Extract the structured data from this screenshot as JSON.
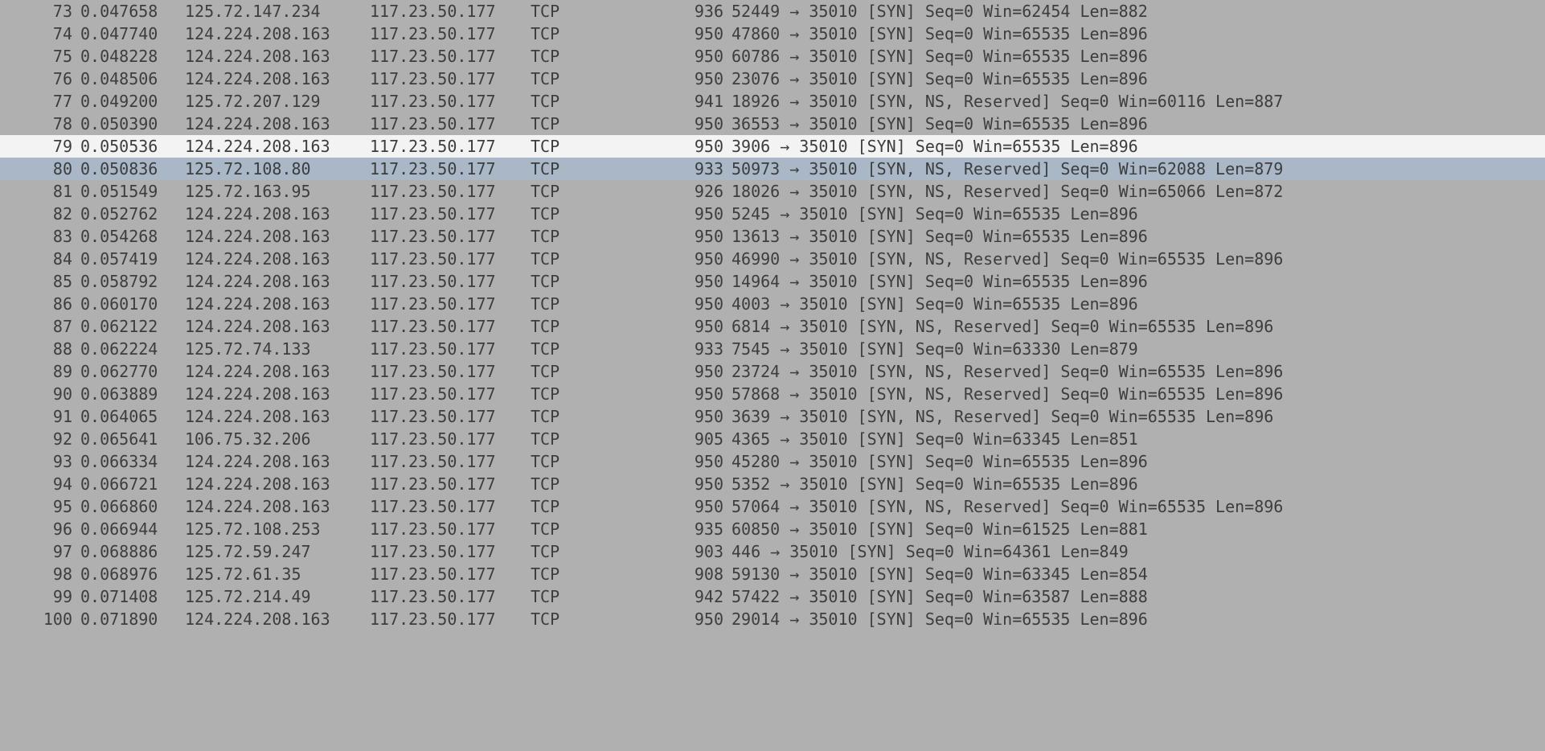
{
  "packets": [
    {
      "no": "73",
      "time": "0.047658",
      "src": "125.72.147.234",
      "dst": "117.23.50.177",
      "proto": "TCP",
      "len": "936",
      "info": "52449 → 35010 [SYN] Seq=0 Win=62454 Len=882",
      "state": "normal"
    },
    {
      "no": "74",
      "time": "0.047740",
      "src": "124.224.208.163",
      "dst": "117.23.50.177",
      "proto": "TCP",
      "len": "950",
      "info": "47860 → 35010 [SYN] Seq=0 Win=65535 Len=896",
      "state": "normal"
    },
    {
      "no": "75",
      "time": "0.048228",
      "src": "124.224.208.163",
      "dst": "117.23.50.177",
      "proto": "TCP",
      "len": "950",
      "info": "60786 → 35010 [SYN] Seq=0 Win=65535 Len=896",
      "state": "normal"
    },
    {
      "no": "76",
      "time": "0.048506",
      "src": "124.224.208.163",
      "dst": "117.23.50.177",
      "proto": "TCP",
      "len": "950",
      "info": "23076 → 35010 [SYN] Seq=0 Win=65535 Len=896",
      "state": "normal"
    },
    {
      "no": "77",
      "time": "0.049200",
      "src": "125.72.207.129",
      "dst": "117.23.50.177",
      "proto": "TCP",
      "len": "941",
      "info": "18926 → 35010 [SYN, NS, Reserved] Seq=0 Win=60116 Len=887",
      "state": "normal"
    },
    {
      "no": "78",
      "time": "0.050390",
      "src": "124.224.208.163",
      "dst": "117.23.50.177",
      "proto": "TCP",
      "len": "950",
      "info": "36553 → 35010 [SYN] Seq=0 Win=65535 Len=896",
      "state": "normal"
    },
    {
      "no": "79",
      "time": "0.050536",
      "src": "124.224.208.163",
      "dst": "117.23.50.177",
      "proto": "TCP",
      "len": "950",
      "info": "3906 → 35010 [SYN] Seq=0 Win=65535 Len=896",
      "state": "white"
    },
    {
      "no": "80",
      "time": "0.050836",
      "src": "125.72.108.80",
      "dst": "117.23.50.177",
      "proto": "TCP",
      "len": "933",
      "info": "50973 → 35010 [SYN, NS, Reserved] Seq=0 Win=62088 Len=879",
      "state": "blue"
    },
    {
      "no": "81",
      "time": "0.051549",
      "src": "125.72.163.95",
      "dst": "117.23.50.177",
      "proto": "TCP",
      "len": "926",
      "info": "18026 → 35010 [SYN, NS, Reserved] Seq=0 Win=65066 Len=872",
      "state": "normal"
    },
    {
      "no": "82",
      "time": "0.052762",
      "src": "124.224.208.163",
      "dst": "117.23.50.177",
      "proto": "TCP",
      "len": "950",
      "info": "5245 → 35010 [SYN] Seq=0 Win=65535 Len=896",
      "state": "normal"
    },
    {
      "no": "83",
      "time": "0.054268",
      "src": "124.224.208.163",
      "dst": "117.23.50.177",
      "proto": "TCP",
      "len": "950",
      "info": "13613 → 35010 [SYN] Seq=0 Win=65535 Len=896",
      "state": "normal"
    },
    {
      "no": "84",
      "time": "0.057419",
      "src": "124.224.208.163",
      "dst": "117.23.50.177",
      "proto": "TCP",
      "len": "950",
      "info": "46990 → 35010 [SYN, NS, Reserved] Seq=0 Win=65535 Len=896",
      "state": "normal"
    },
    {
      "no": "85",
      "time": "0.058792",
      "src": "124.224.208.163",
      "dst": "117.23.50.177",
      "proto": "TCP",
      "len": "950",
      "info": "14964 → 35010 [SYN] Seq=0 Win=65535 Len=896",
      "state": "normal"
    },
    {
      "no": "86",
      "time": "0.060170",
      "src": "124.224.208.163",
      "dst": "117.23.50.177",
      "proto": "TCP",
      "len": "950",
      "info": "4003 → 35010 [SYN] Seq=0 Win=65535 Len=896",
      "state": "normal"
    },
    {
      "no": "87",
      "time": "0.062122",
      "src": "124.224.208.163",
      "dst": "117.23.50.177",
      "proto": "TCP",
      "len": "950",
      "info": "6814 → 35010 [SYN, NS, Reserved] Seq=0 Win=65535 Len=896",
      "state": "normal"
    },
    {
      "no": "88",
      "time": "0.062224",
      "src": "125.72.74.133",
      "dst": "117.23.50.177",
      "proto": "TCP",
      "len": "933",
      "info": "7545 → 35010 [SYN] Seq=0 Win=63330 Len=879",
      "state": "normal"
    },
    {
      "no": "89",
      "time": "0.062770",
      "src": "124.224.208.163",
      "dst": "117.23.50.177",
      "proto": "TCP",
      "len": "950",
      "info": "23724 → 35010 [SYN, NS, Reserved] Seq=0 Win=65535 Len=896",
      "state": "normal"
    },
    {
      "no": "90",
      "time": "0.063889",
      "src": "124.224.208.163",
      "dst": "117.23.50.177",
      "proto": "TCP",
      "len": "950",
      "info": "57868 → 35010 [SYN, NS, Reserved] Seq=0 Win=65535 Len=896",
      "state": "normal"
    },
    {
      "no": "91",
      "time": "0.064065",
      "src": "124.224.208.163",
      "dst": "117.23.50.177",
      "proto": "TCP",
      "len": "950",
      "info": "3639 → 35010 [SYN, NS, Reserved] Seq=0 Win=65535 Len=896",
      "state": "normal"
    },
    {
      "no": "92",
      "time": "0.065641",
      "src": "106.75.32.206",
      "dst": "117.23.50.177",
      "proto": "TCP",
      "len": "905",
      "info": "4365 → 35010 [SYN] Seq=0 Win=63345 Len=851",
      "state": "normal"
    },
    {
      "no": "93",
      "time": "0.066334",
      "src": "124.224.208.163",
      "dst": "117.23.50.177",
      "proto": "TCP",
      "len": "950",
      "info": "45280 → 35010 [SYN] Seq=0 Win=65535 Len=896",
      "state": "normal"
    },
    {
      "no": "94",
      "time": "0.066721",
      "src": "124.224.208.163",
      "dst": "117.23.50.177",
      "proto": "TCP",
      "len": "950",
      "info": "5352 → 35010 [SYN] Seq=0 Win=65535 Len=896",
      "state": "normal"
    },
    {
      "no": "95",
      "time": "0.066860",
      "src": "124.224.208.163",
      "dst": "117.23.50.177",
      "proto": "TCP",
      "len": "950",
      "info": "57064 → 35010 [SYN, NS, Reserved] Seq=0 Win=65535 Len=896",
      "state": "normal"
    },
    {
      "no": "96",
      "time": "0.066944",
      "src": "125.72.108.253",
      "dst": "117.23.50.177",
      "proto": "TCP",
      "len": "935",
      "info": "60850 → 35010 [SYN] Seq=0 Win=61525 Len=881",
      "state": "normal"
    },
    {
      "no": "97",
      "time": "0.068886",
      "src": "125.72.59.247",
      "dst": "117.23.50.177",
      "proto": "TCP",
      "len": "903",
      "info": "446 → 35010 [SYN] Seq=0 Win=64361 Len=849",
      "state": "normal"
    },
    {
      "no": "98",
      "time": "0.068976",
      "src": "125.72.61.35",
      "dst": "117.23.50.177",
      "proto": "TCP",
      "len": "908",
      "info": "59130 → 35010 [SYN] Seq=0 Win=63345 Len=854",
      "state": "normal"
    },
    {
      "no": "99",
      "time": "0.071408",
      "src": "125.72.214.49",
      "dst": "117.23.50.177",
      "proto": "TCP",
      "len": "942",
      "info": "57422 → 35010 [SYN] Seq=0 Win=63587 Len=888",
      "state": "normal"
    },
    {
      "no": "100",
      "time": "0.071890",
      "src": "124.224.208.163",
      "dst": "117.23.50.177",
      "proto": "TCP",
      "len": "950",
      "info": "29014 → 35010 [SYN] Seq=0 Win=65535 Len=896",
      "state": "normal"
    }
  ]
}
